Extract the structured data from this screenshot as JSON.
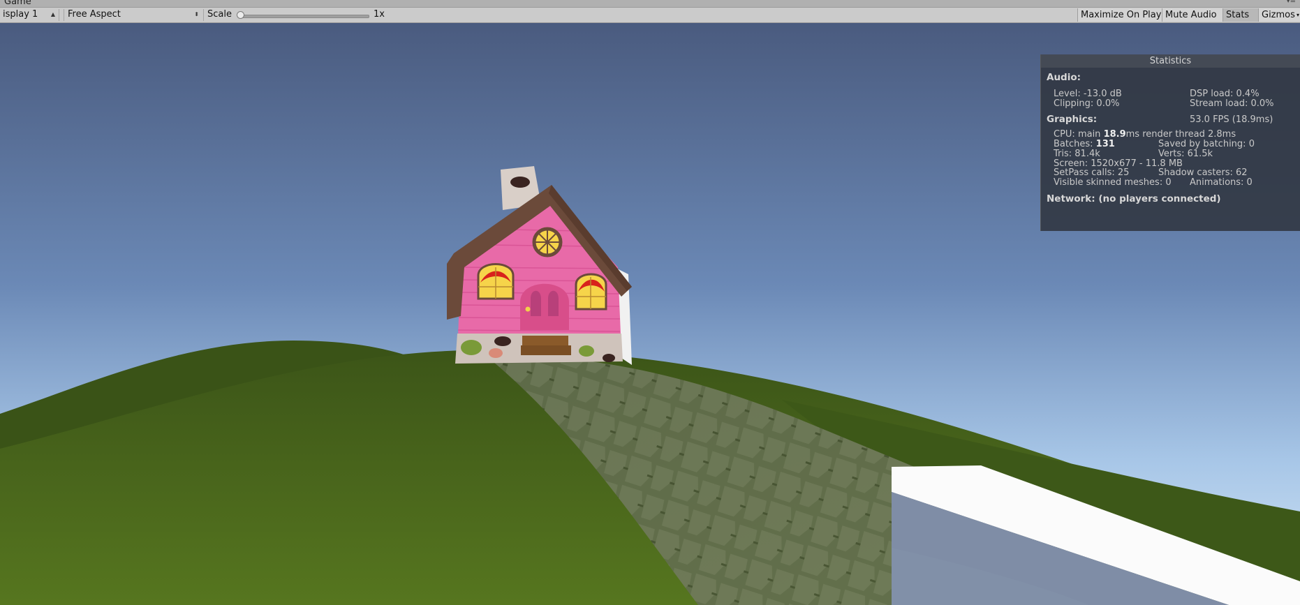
{
  "window": {
    "title": "Game"
  },
  "toolbar": {
    "display": "isplay 1",
    "aspect": "Free Aspect",
    "scale_label": "Scale",
    "scale_value": "1x",
    "scale_level": 0.0,
    "buttons": {
      "maximize": "Maximize On Play",
      "mute": "Mute Audio",
      "stats": "Stats",
      "gizmos": "Gizmos"
    }
  },
  "stats": {
    "title": "Statistics",
    "audio": {
      "header": "Audio:",
      "level": "Level: -13.0 dB",
      "dsp": "DSP load: 0.4%",
      "clipping": "Clipping: 0.0%",
      "stream": "Stream load: 0.0%"
    },
    "graphics": {
      "header": "Graphics:",
      "fps": "53.0 FPS (18.9ms)",
      "cpu_prefix": "CPU: main ",
      "cpu_main": "18.9",
      "cpu_suffix": "ms  render thread 2.8ms",
      "batches_prefix": "Batches: ",
      "batches": "131",
      "saved": "Saved by batching: 0",
      "tris": "Tris: 81.4k",
      "verts": "Verts: 61.5k",
      "screen": "Screen: 1520x677 - 11.8 MB",
      "setpass": "SetPass calls: 25",
      "shadow": "Shadow casters: 62",
      "skinned": "Visible skinned meshes: 0",
      "animations": "Animations: 0"
    },
    "network": "Network: (no players connected)"
  },
  "colors": {
    "sky_top": "#4a5c80",
    "sky_bottom": "#bcd6ee",
    "grass": "#4b6a1e",
    "house_pink": "#e86aa8",
    "roof": "#6b4a3a"
  }
}
